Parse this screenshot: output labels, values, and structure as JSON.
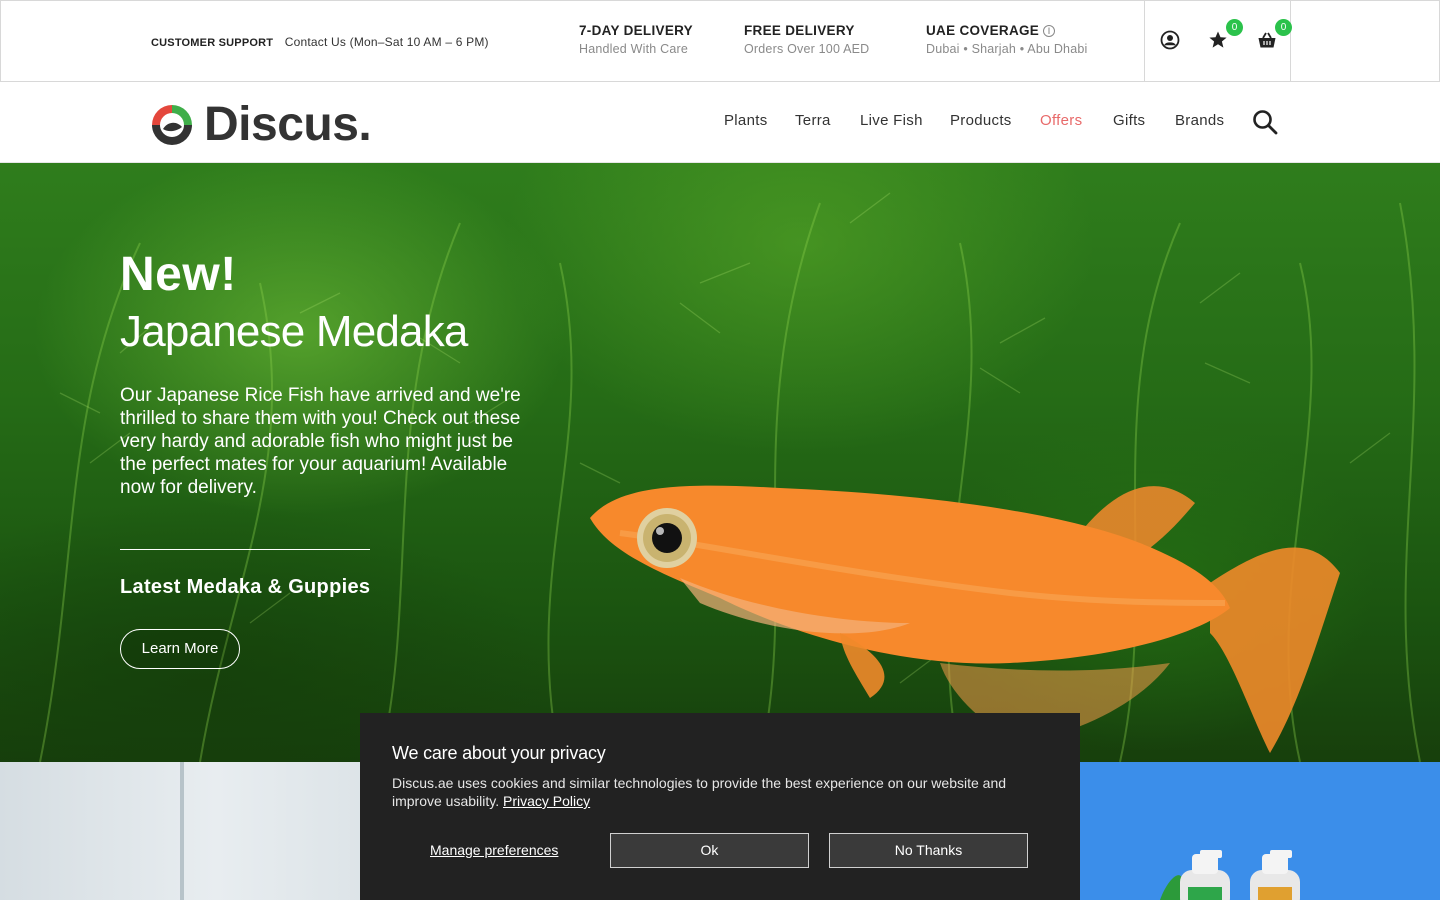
{
  "topbar": {
    "support_label": "Customer Support",
    "support_text": "Contact Us (Mon–Sat 10 AM – 6 PM)",
    "perks": [
      {
        "heading": "7-Day Delivery",
        "sub": "Handled With Care"
      },
      {
        "heading": "Free Delivery",
        "sub": "Orders Over 100 AED"
      },
      {
        "heading": "UAE Coverage",
        "sub": "Dubai • Sharjah • Abu Dhabi"
      }
    ],
    "wishlist_count": "0",
    "cart_count": "0",
    "info_glyph": "i"
  },
  "brand": {
    "name": "Discus.",
    "colors": {
      "red": "#e4473c",
      "green": "#3fae49",
      "dark": "#333333"
    }
  },
  "nav": {
    "items": [
      "Plants",
      "Terra",
      "Live Fish",
      "Products",
      "Offers",
      "Gifts",
      "Brands"
    ],
    "offers_color": "#e86a6a"
  },
  "hero": {
    "eyebrow": "New!",
    "title": "Japanese Medaka",
    "body": "Our Japanese Rice Fish have arrived and we're thrilled to share them with you! Check out these very hardy and adorable fish who might just be the perfect mates for your aquarium! Available now for delivery.",
    "subheading": "Latest Medaka & Guppies",
    "cta": "Learn More"
  },
  "cookie": {
    "title": "We care about your privacy",
    "text": "Discus.ae uses cookies and similar technologies to provide the best experience on our website and improve usability.",
    "policy_link": "Privacy Policy",
    "manage": "Manage preferences",
    "ok": "Ok",
    "no": "No Thanks"
  }
}
